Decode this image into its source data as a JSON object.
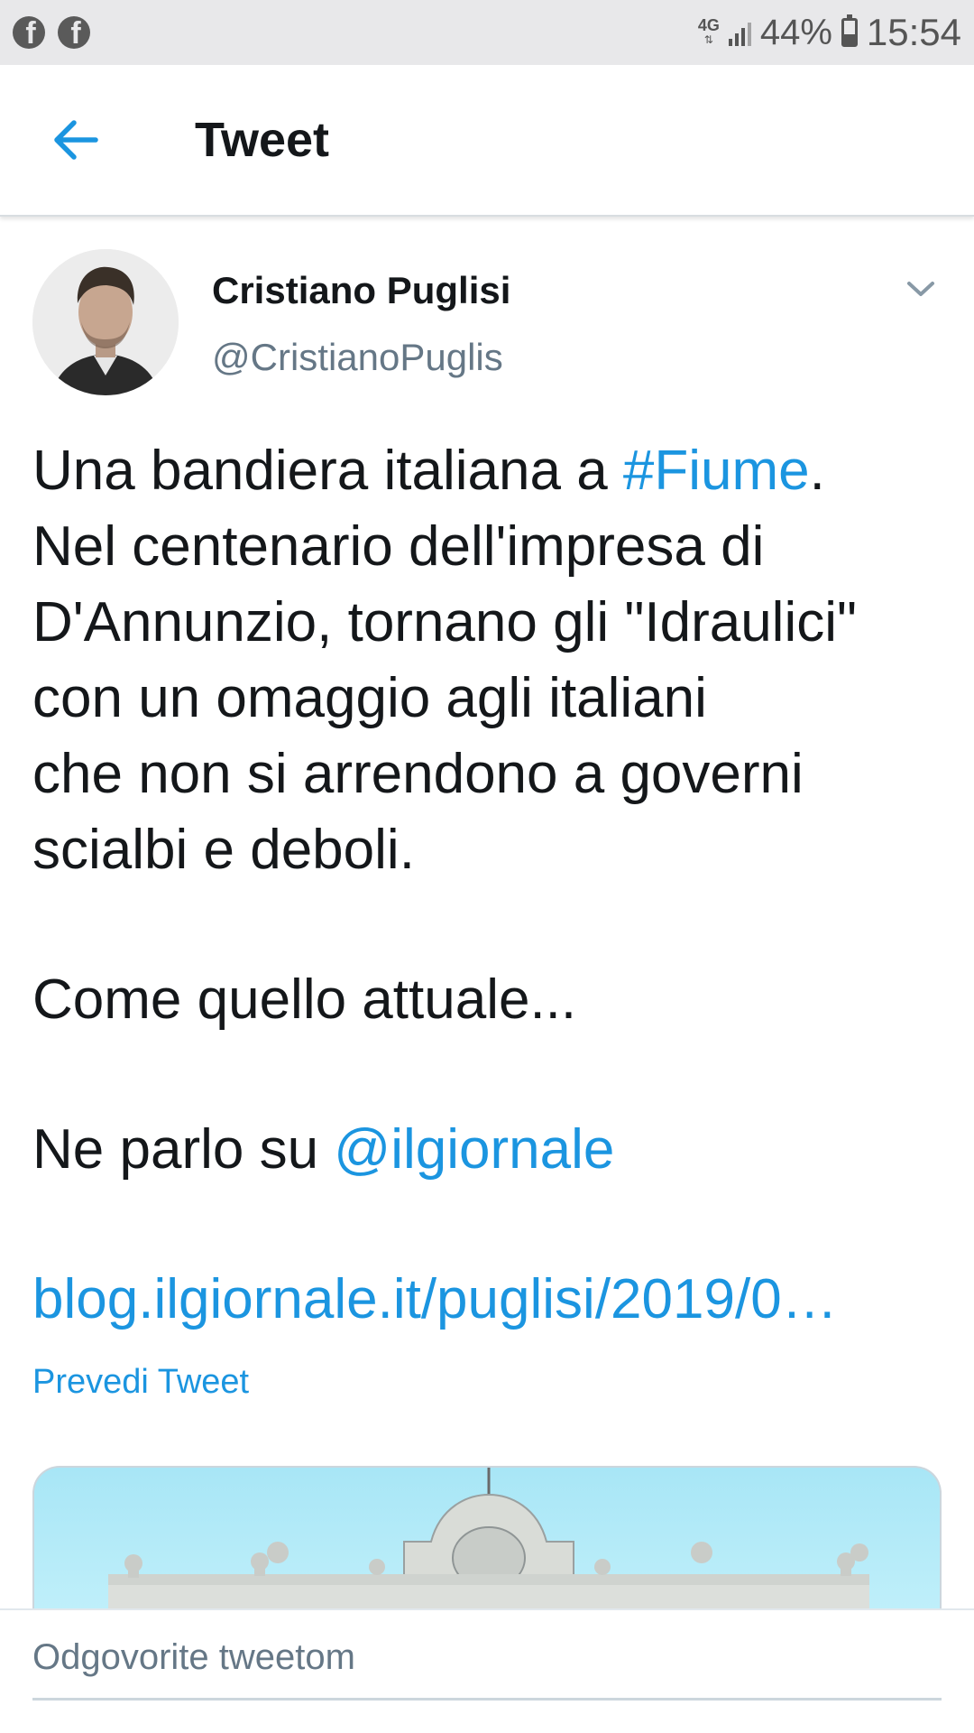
{
  "status_bar": {
    "left_icons": [
      "facebook-icon",
      "facebook-icon"
    ],
    "network": "4G",
    "battery_percent": "44%",
    "battery_level": 0.44,
    "time": "15:54"
  },
  "header": {
    "back_icon": "arrow-left-icon",
    "title": "Tweet"
  },
  "tweet": {
    "author": {
      "display_name": "Cristiano Puglisi",
      "handle": "@CristianoPuglis"
    },
    "text": {
      "line1_pre": "Una bandiera italiana a ",
      "hashtag": "#Fiume",
      "line1_post": ".",
      "line2": "Nel centenario dell'impresa di",
      "line3": "D'Annunzio, tornano gli \"Idraulici\"",
      "line4": "con un omaggio agli italiani",
      "line5": "che non si arrendono a governi",
      "line6": "scialbi e deboli.",
      "line7": "Come quello attuale...",
      "line8_pre": "Ne parlo su ",
      "mention": "@ilgiornale",
      "url": "blog.ilgiornale.it/puglisi/2019/0…"
    },
    "translate_label": "Prevedi Tweet",
    "accent_color": "#1b95e0"
  },
  "reply": {
    "placeholder": "Odgovorite tweetom"
  }
}
